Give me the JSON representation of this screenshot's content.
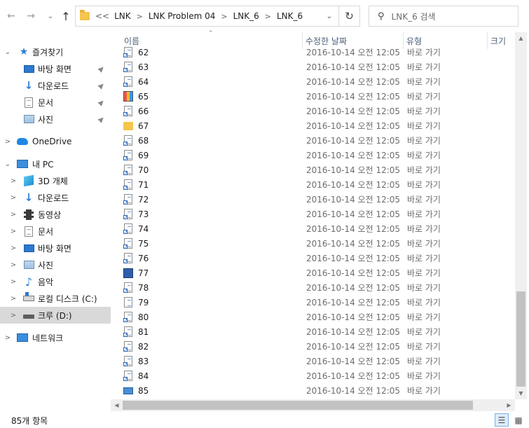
{
  "address_bar": {
    "overflow": "<<",
    "breadcrumbs": [
      "LNK",
      "LNK Problem 04",
      "LNK_6",
      "LNK_6"
    ],
    "refresh_icon": "refresh-icon",
    "dropdown_icon": "chevron-down-icon"
  },
  "search": {
    "placeholder": "LNK_6 검색"
  },
  "nav_buttons": {
    "back": "←",
    "forward": "→",
    "recent": "⌄",
    "up": "↑"
  },
  "nav_pane": {
    "quick_access": "즐겨찾기",
    "quick_items": [
      "바탕 화면",
      "다운로드",
      "문서",
      "사진"
    ],
    "onedrive": "OneDrive",
    "this_pc": "내 PC",
    "pc_items": [
      "3D 개체",
      "다운로드",
      "동영상",
      "문서",
      "바탕 화면",
      "사진",
      "음악",
      "로컬 디스크 (C:)",
      "크루 (D:)"
    ],
    "network": "네트워크",
    "selected": "크루 (D:)"
  },
  "columns": {
    "name": "이름",
    "modified": "수정한 날짜",
    "type": "유형",
    "size": "크기"
  },
  "files": [
    {
      "name": "62",
      "date": "2016-10-14 오전 12:05",
      "type": "바로 가기",
      "icon": "shortcut"
    },
    {
      "name": "63",
      "date": "2016-10-14 오전 12:05",
      "type": "바로 가기",
      "icon": "shortcut"
    },
    {
      "name": "64",
      "date": "2016-10-14 오전 12:05",
      "type": "바로 가기",
      "icon": "shortcut"
    },
    {
      "name": "65",
      "date": "2016-10-14 오전 12:05",
      "type": "바로 가기",
      "icon": "colorful"
    },
    {
      "name": "66",
      "date": "2016-10-14 오전 12:05",
      "type": "바로 가기",
      "icon": "shortcut"
    },
    {
      "name": "67",
      "date": "2016-10-14 오전 12:05",
      "type": "바로 가기",
      "icon": "folder"
    },
    {
      "name": "68",
      "date": "2016-10-14 오전 12:05",
      "type": "바로 가기",
      "icon": "shortcut"
    },
    {
      "name": "69",
      "date": "2016-10-14 오전 12:05",
      "type": "바로 가기",
      "icon": "shortcut"
    },
    {
      "name": "70",
      "date": "2016-10-14 오전 12:05",
      "type": "바로 가기",
      "icon": "shortcut"
    },
    {
      "name": "71",
      "date": "2016-10-14 오전 12:05",
      "type": "바로 가기",
      "icon": "shortcut"
    },
    {
      "name": "72",
      "date": "2016-10-14 오전 12:05",
      "type": "바로 가기",
      "icon": "shortcut"
    },
    {
      "name": "73",
      "date": "2016-10-14 오전 12:05",
      "type": "바로 가기",
      "icon": "shortcut"
    },
    {
      "name": "74",
      "date": "2016-10-14 오전 12:05",
      "type": "바로 가기",
      "icon": "shortcut"
    },
    {
      "name": "75",
      "date": "2016-10-14 오전 12:05",
      "type": "바로 가기",
      "icon": "shortcut"
    },
    {
      "name": "76",
      "date": "2016-10-14 오전 12:05",
      "type": "바로 가기",
      "icon": "shortcut"
    },
    {
      "name": "77",
      "date": "2016-10-14 오전 12:05",
      "type": "바로 가기",
      "icon": "blue"
    },
    {
      "name": "78",
      "date": "2016-10-14 오전 12:05",
      "type": "바로 가기",
      "icon": "shortcut"
    },
    {
      "name": "79",
      "date": "2016-10-14 오전 12:05",
      "type": "바로 가기",
      "icon": "page"
    },
    {
      "name": "80",
      "date": "2016-10-14 오전 12:05",
      "type": "바로 가기",
      "icon": "shortcut"
    },
    {
      "name": "81",
      "date": "2016-10-14 오전 12:05",
      "type": "바로 가기",
      "icon": "shortcut"
    },
    {
      "name": "82",
      "date": "2016-10-14 오전 12:05",
      "type": "바로 가기",
      "icon": "shortcut"
    },
    {
      "name": "83",
      "date": "2016-10-14 오전 12:05",
      "type": "바로 가기",
      "icon": "shortcut"
    },
    {
      "name": "84",
      "date": "2016-10-14 오전 12:05",
      "type": "바로 가기",
      "icon": "shortcut"
    },
    {
      "name": "85",
      "date": "2016-10-14 오전 12:05",
      "type": "바로 가기",
      "icon": "keyboard"
    }
  ],
  "status": {
    "item_count": "85개 항목"
  }
}
